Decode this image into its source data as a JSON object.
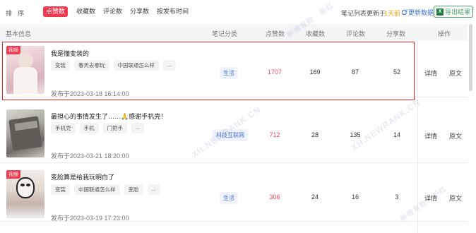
{
  "toolbar": {
    "sort_label": "排序",
    "sort_options": [
      "点赞数",
      "收藏数",
      "评论数",
      "分享数",
      "按发布时间"
    ],
    "update_prefix": "笔记列表更新于",
    "update_days": "1天前",
    "refresh_label": "更新数据",
    "export_label": "导出结果",
    "excel_icon_text": "X"
  },
  "columns": [
    "基本信息",
    "笔记分类",
    "点赞数",
    "收藏数",
    "评论数",
    "分享数",
    "操作"
  ],
  "rows": [
    {
      "badge": "视频",
      "title": "我是懂变装的",
      "tags": [
        "变装",
        "春天去哪玩",
        "中国联通怎么样",
        "..."
      ],
      "published": "发布于2023-03-18 16:14:00",
      "category": "生活",
      "likes": "1707",
      "favorites": "169",
      "comments": "87",
      "shares": "52",
      "op_detail": "详情",
      "op_source": "原文"
    },
    {
      "badge": "",
      "title": "最担心的事情发生了……🙏感谢手机壳！",
      "tags": [
        "手机壳",
        "手机",
        "门把手",
        "..."
      ],
      "published": "发布于2023-03-21 18:20:00",
      "category": "科技互联网",
      "likes": "712",
      "favorites": "28",
      "comments": "135",
      "shares": "14",
      "op_detail": "详情",
      "op_source": "原文"
    },
    {
      "badge": "视频",
      "title": "变脸算是给我玩明白了",
      "tags": [
        "变装",
        "中国联通怎么样",
        "变脸",
        "..."
      ],
      "published": "发布于2023-03-19 17:23:00",
      "category": "生活",
      "likes": "306",
      "favorites": "24",
      "comments": "16",
      "shares": "3",
      "op_detail": "详情",
      "op_source": "原文"
    }
  ],
  "watermarks": [
    "新榜有数 · 新红",
    "XH.NEWRANK.CN",
    "新榜有数 · 新红",
    "XH.NEWRANK.CN"
  ],
  "colors": {
    "accent_red": "#f2394f",
    "like_red": "#e94a5a",
    "link_blue": "#3b6fe8",
    "export_green": "#46a35e",
    "highlight_border": "#e0261c"
  }
}
